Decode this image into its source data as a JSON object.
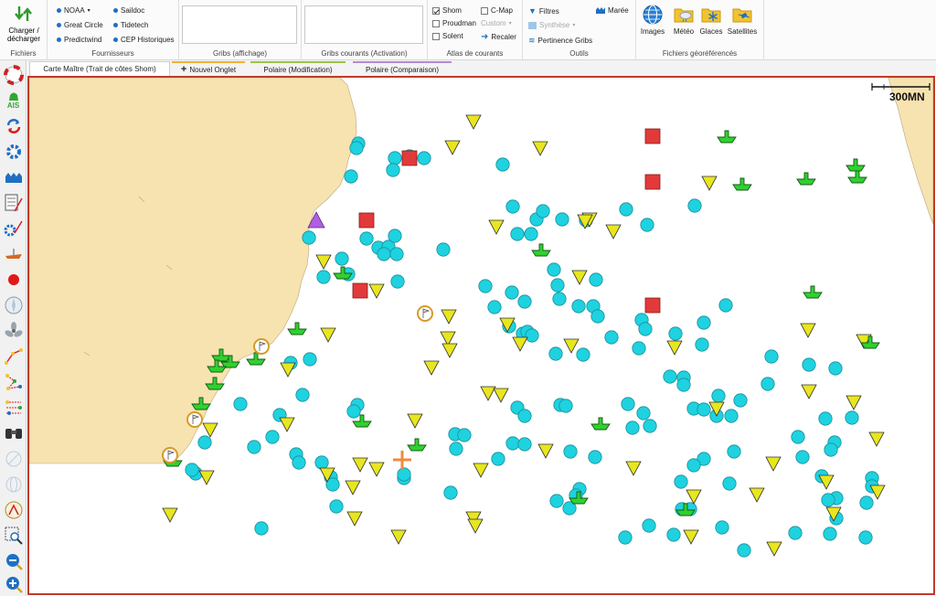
{
  "ribbon": {
    "fichiers": {
      "button_label": "Charger / décharger",
      "group_label": "Fichiers"
    },
    "fournisseurs": {
      "items": [
        "NOAA",
        "Saildoc",
        "Great Circle",
        "Tidetech",
        "Predictwind",
        "CEP Historiques"
      ],
      "group_label": "Fournisseurs"
    },
    "gribs_affichage": {
      "group_label": "Gribs (affichage)"
    },
    "gribs_courants": {
      "group_label": "Gribs courants (Activation)"
    },
    "atlas": {
      "shom": "Shom",
      "cmap": "C-Map",
      "proudman": "Proudman",
      "custom": "Custom",
      "solent": "Solent",
      "recaler": "Recaler",
      "group_label": "Atlas de courants"
    },
    "outils": {
      "filtres": "Filtres",
      "maree": "Marée",
      "synthese": "Synthèse",
      "pertinence": "Pertinence Gribs",
      "group_label": "Outils"
    },
    "fichiers_geo": {
      "images": "Images",
      "meteo": "Météo",
      "glaces": "Glaces",
      "satellites": "Satellites",
      "group_label": "Fichiers géoréférencés"
    }
  },
  "tabs": [
    "Carte Maître (Trait de côtes Shom)",
    "Nouvel Onglet",
    "Polaire (Modification)",
    "Polaire (Comparaison)"
  ],
  "map": {
    "scale_label": "300MN",
    "colors": {
      "land": "#f6e3b0",
      "buoy": "#1ed2e0",
      "triangle": "#e8e61e",
      "ship": "#2fd12f",
      "square": "#e23a3a",
      "frame": "#c0392b"
    }
  }
}
